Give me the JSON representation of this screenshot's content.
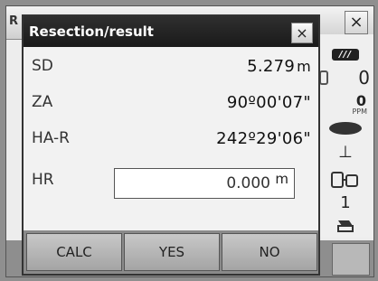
{
  "background_window": {
    "title_fragment": "R",
    "close_label": "×"
  },
  "status_panel": {
    "battery_label": "///",
    "prism_constant": "0",
    "ppm_value": "0",
    "ppm_unit": "PPM",
    "tilt_symbol": "⊥",
    "input_mode": "1"
  },
  "dialog": {
    "title": "Resection/result",
    "close_label": "×",
    "rows": [
      {
        "label": "SD",
        "value": "5.279",
        "unit": "m"
      },
      {
        "label": "ZA",
        "value": "90º00'07\""
      },
      {
        "label": "HA-R",
        "value": "242º29'06\""
      }
    ],
    "hr": {
      "label": "HR",
      "value": "0.000",
      "unit": "m"
    }
  },
  "buttons": {
    "calc": "CALC",
    "yes": "YES",
    "no": "NO"
  }
}
